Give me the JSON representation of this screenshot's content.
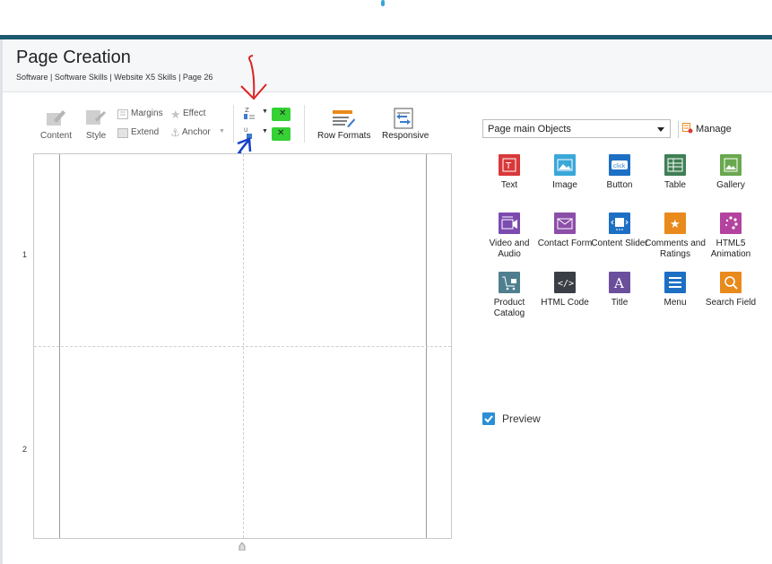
{
  "header": {
    "title": "Page Creation",
    "breadcrumb": "Software | Software Skills | Website X5 Skills | Page 26"
  },
  "toolbar": {
    "content_label": "Content",
    "style_label": "Style",
    "margins_label": "Margins",
    "effect_label": "Effect",
    "extend_label": "Extend",
    "anchor_label": "Anchor",
    "row_formats_label": "Row Formats",
    "responsive_label": "Responsive"
  },
  "canvas": {
    "row_numbers": [
      "1",
      "2"
    ]
  },
  "objects_panel": {
    "dropdown_value": "Page main Objects",
    "manage_label": "Manage",
    "items": [
      {
        "label": "Text",
        "color": "#d9383a"
      },
      {
        "label": "Image",
        "color": "#3ba7d8"
      },
      {
        "label": "Button",
        "color": "#1d6fc4"
      },
      {
        "label": "Table",
        "color": "#3f7f55"
      },
      {
        "label": "Gallery",
        "color": "#6aa84f"
      },
      {
        "label": "Video and Audio",
        "color": "#7b4bb0"
      },
      {
        "label": "Contact Form",
        "color": "#8c4ea8"
      },
      {
        "label": "Content Slider",
        "color": "#1d6fc4"
      },
      {
        "label": "Comments and Ratings",
        "color": "#e98a1c"
      },
      {
        "label": "HTML5 Animation",
        "color": "#b3439e"
      },
      {
        "label": "Product Catalog",
        "color": "#4f7f8e"
      },
      {
        "label": "HTML Code",
        "color": "#3a3f45"
      },
      {
        "label": "Title",
        "color": "#6b4f9c"
      },
      {
        "label": "Menu",
        "color": "#1d6fc4"
      },
      {
        "label": "Search Field",
        "color": "#e98a1c"
      }
    ],
    "preview_label": "Preview",
    "preview_checked": true
  },
  "annotations": {
    "red_arrow_color": "#d22",
    "blue_arrow_color": "#1540c8",
    "highlight_color": "#35d135"
  }
}
